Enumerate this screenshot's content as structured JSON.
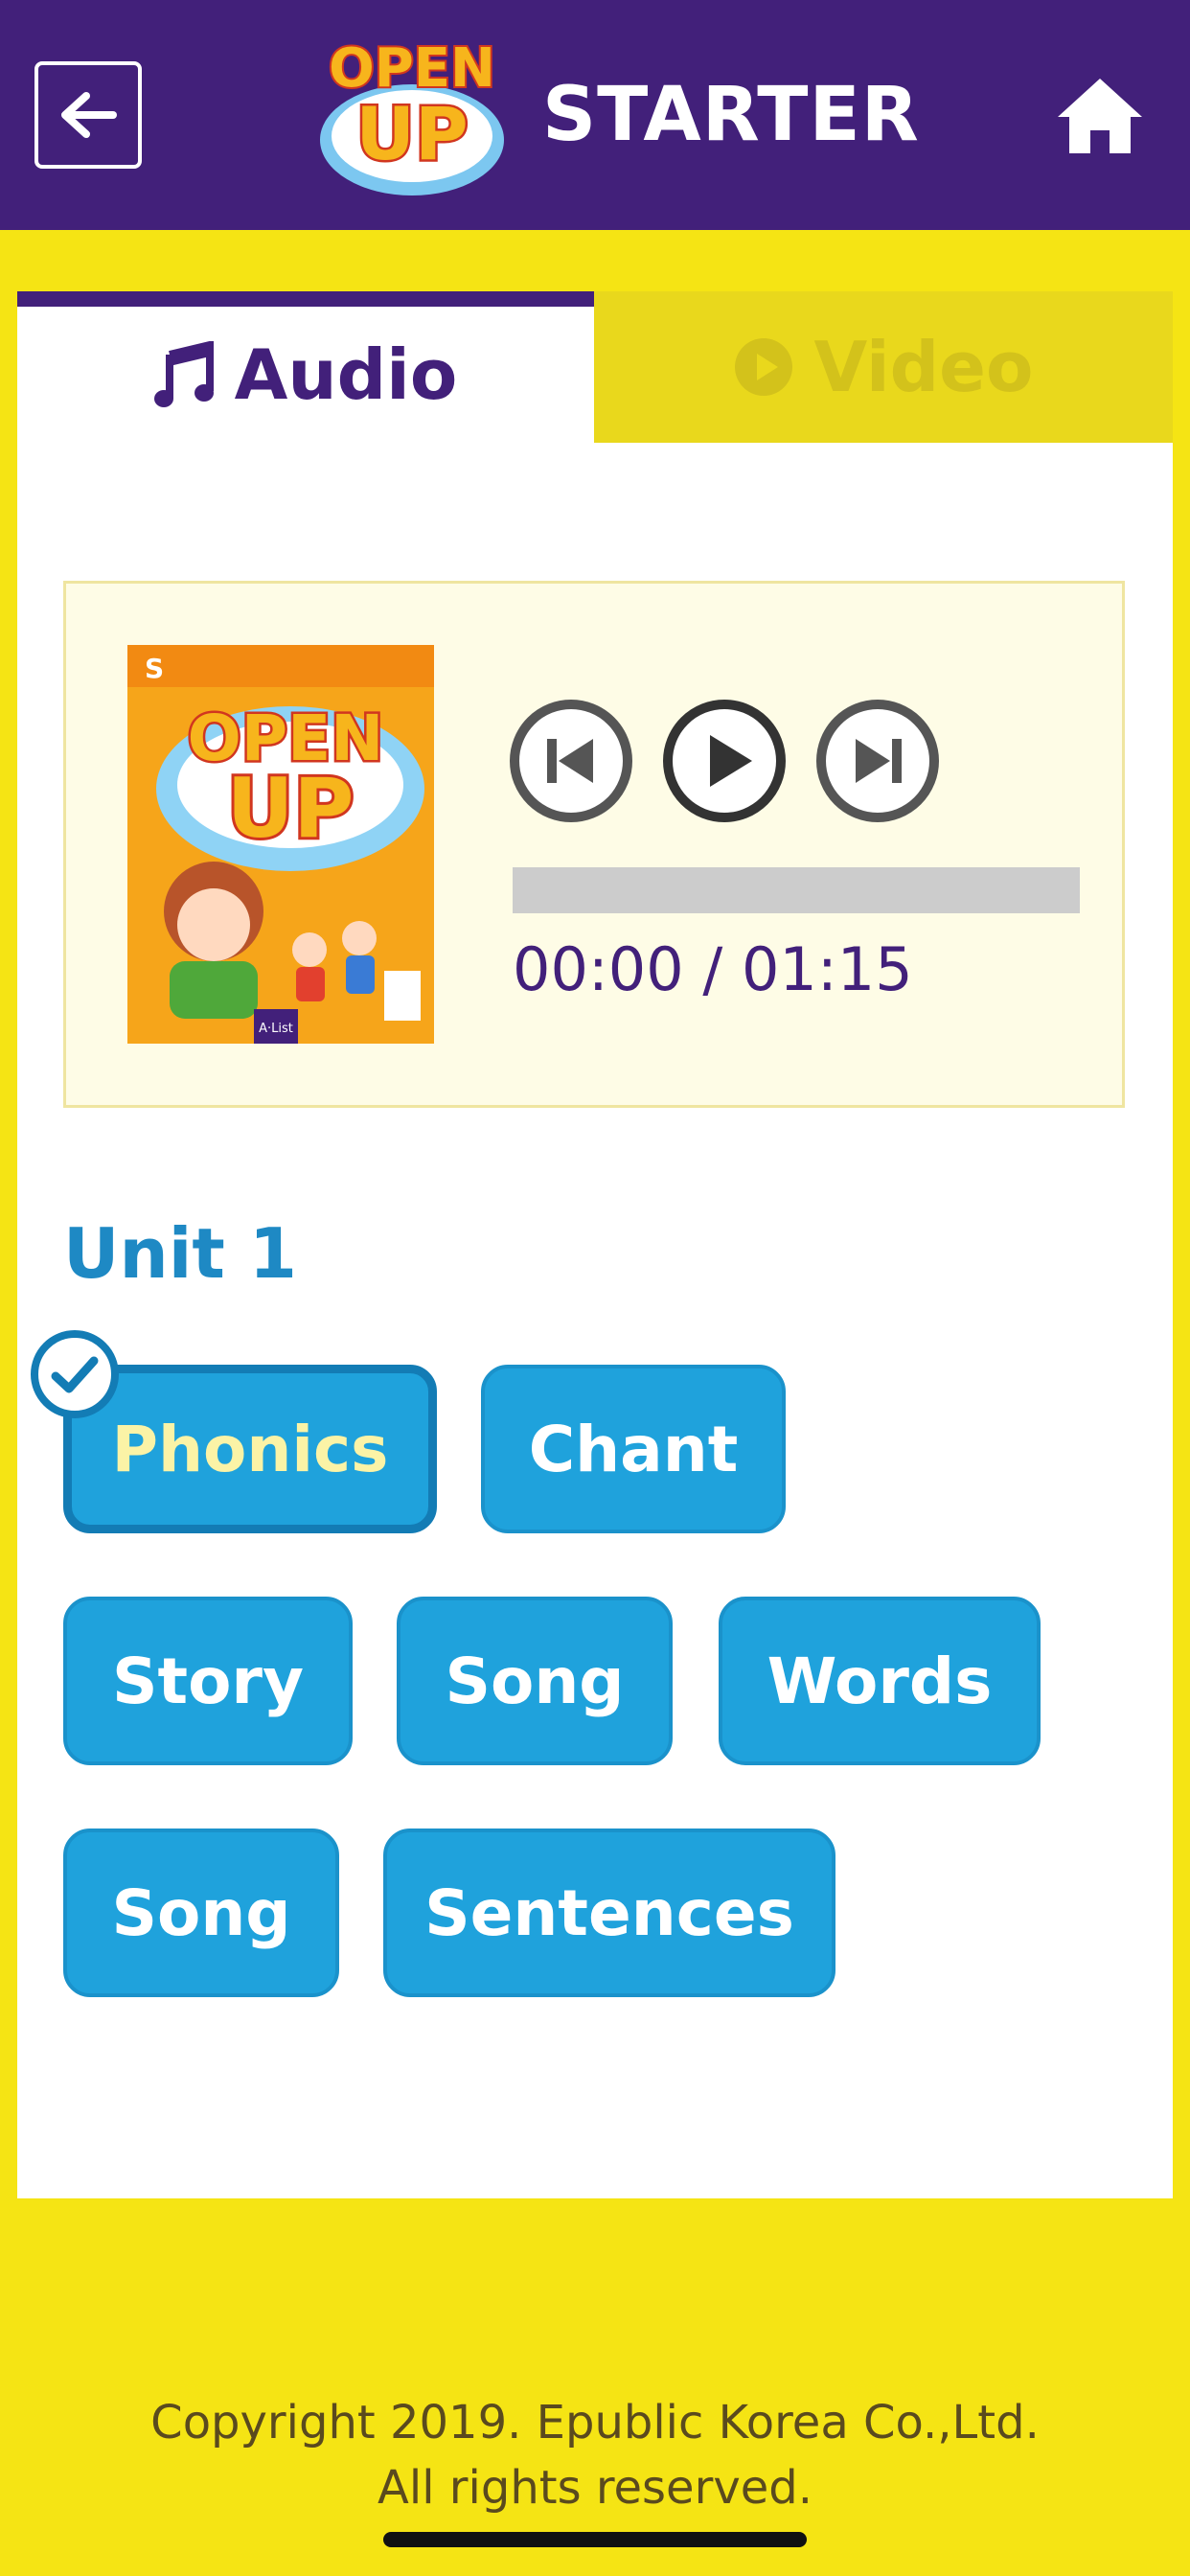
{
  "header": {
    "title": "STARTER",
    "logo_text_top": "OPEN",
    "logo_text_bottom": "UP"
  },
  "tabs": [
    {
      "label": "Audio",
      "icon": "music-note-icon",
      "active": true
    },
    {
      "label": "Video",
      "icon": "play-circle-icon",
      "active": false
    }
  ],
  "player": {
    "cover": {
      "badge": "S",
      "series_top": "OPEN",
      "series_bottom": "UP",
      "publisher": "A·List"
    },
    "time_display": "00:00 / 01:15",
    "progress": 0
  },
  "unit": {
    "title": "Unit 1",
    "buttons": [
      {
        "label": "Phonics",
        "selected": true
      },
      {
        "label": "Chant",
        "selected": false
      },
      {
        "label": "Story",
        "selected": false
      },
      {
        "label": "Song",
        "selected": false
      },
      {
        "label": "Words",
        "selected": false
      },
      {
        "label": "Song",
        "selected": false
      },
      {
        "label": "Sentences",
        "selected": false
      }
    ]
  },
  "footer": {
    "line1": "Copyright 2019. Epublic Korea Co.,Ltd.",
    "line2": "All rights reserved."
  },
  "colors": {
    "header_bg": "#42207a",
    "page_bg": "#f5e414",
    "chip_bg": "#1fa2dc",
    "unit_title": "#1e89c4"
  }
}
